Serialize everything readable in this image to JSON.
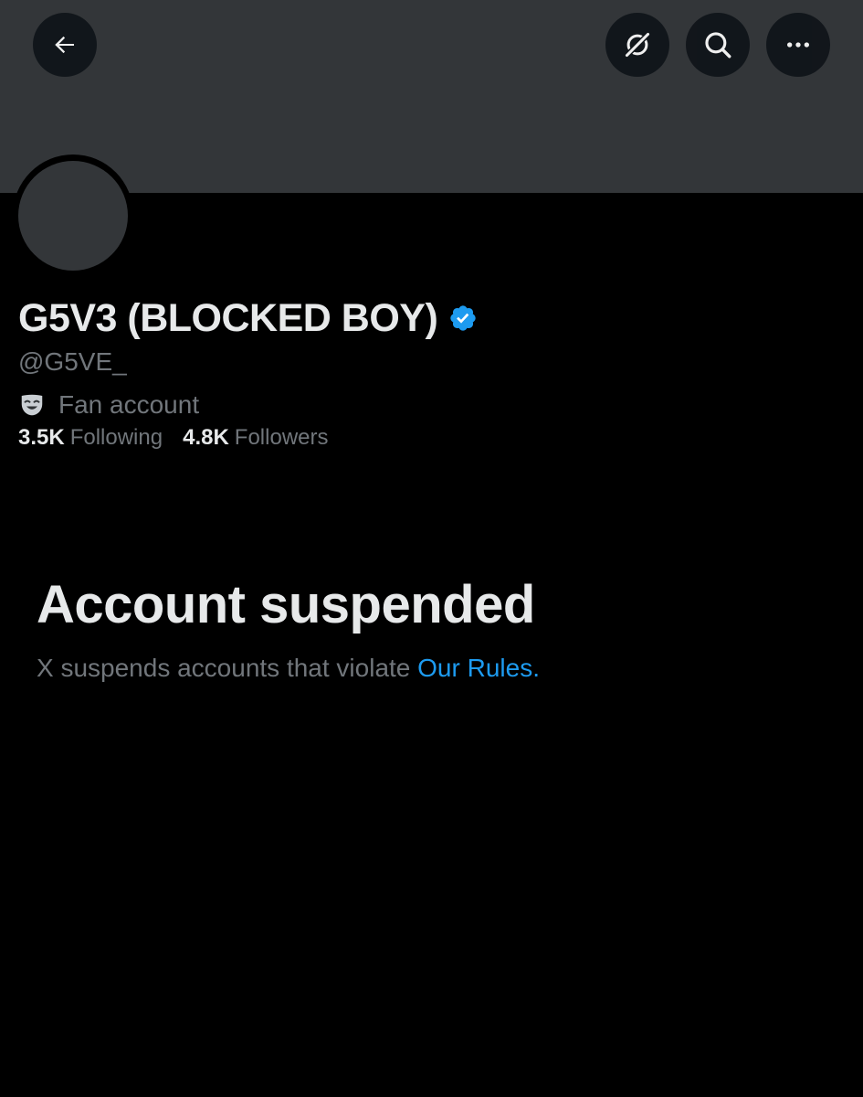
{
  "header": {
    "back_icon": "arrow-left-icon",
    "grok_icon": "grok-icon",
    "search_icon": "search-icon",
    "more_icon": "more-horizontal-icon"
  },
  "profile": {
    "display_name": "G5V3 (BLOCKED BOY)",
    "verified": true,
    "verified_color": "#1d9bf0",
    "handle": "@G5VE_",
    "category_icon": "theater-mask-icon",
    "category": "Fan account",
    "following_count": "3.5K",
    "following_label": "Following",
    "followers_count": "4.8K",
    "followers_label": "Followers"
  },
  "notice": {
    "title": "Account suspended",
    "body_prefix": "X suspends accounts that violate ",
    "link_label": "Our Rules",
    "body_suffix": "."
  },
  "colors": {
    "background": "#000000",
    "banner": "#333639",
    "primary_text": "#e7e9ea",
    "secondary_text": "#71767b",
    "link": "#1d9bf0"
  }
}
